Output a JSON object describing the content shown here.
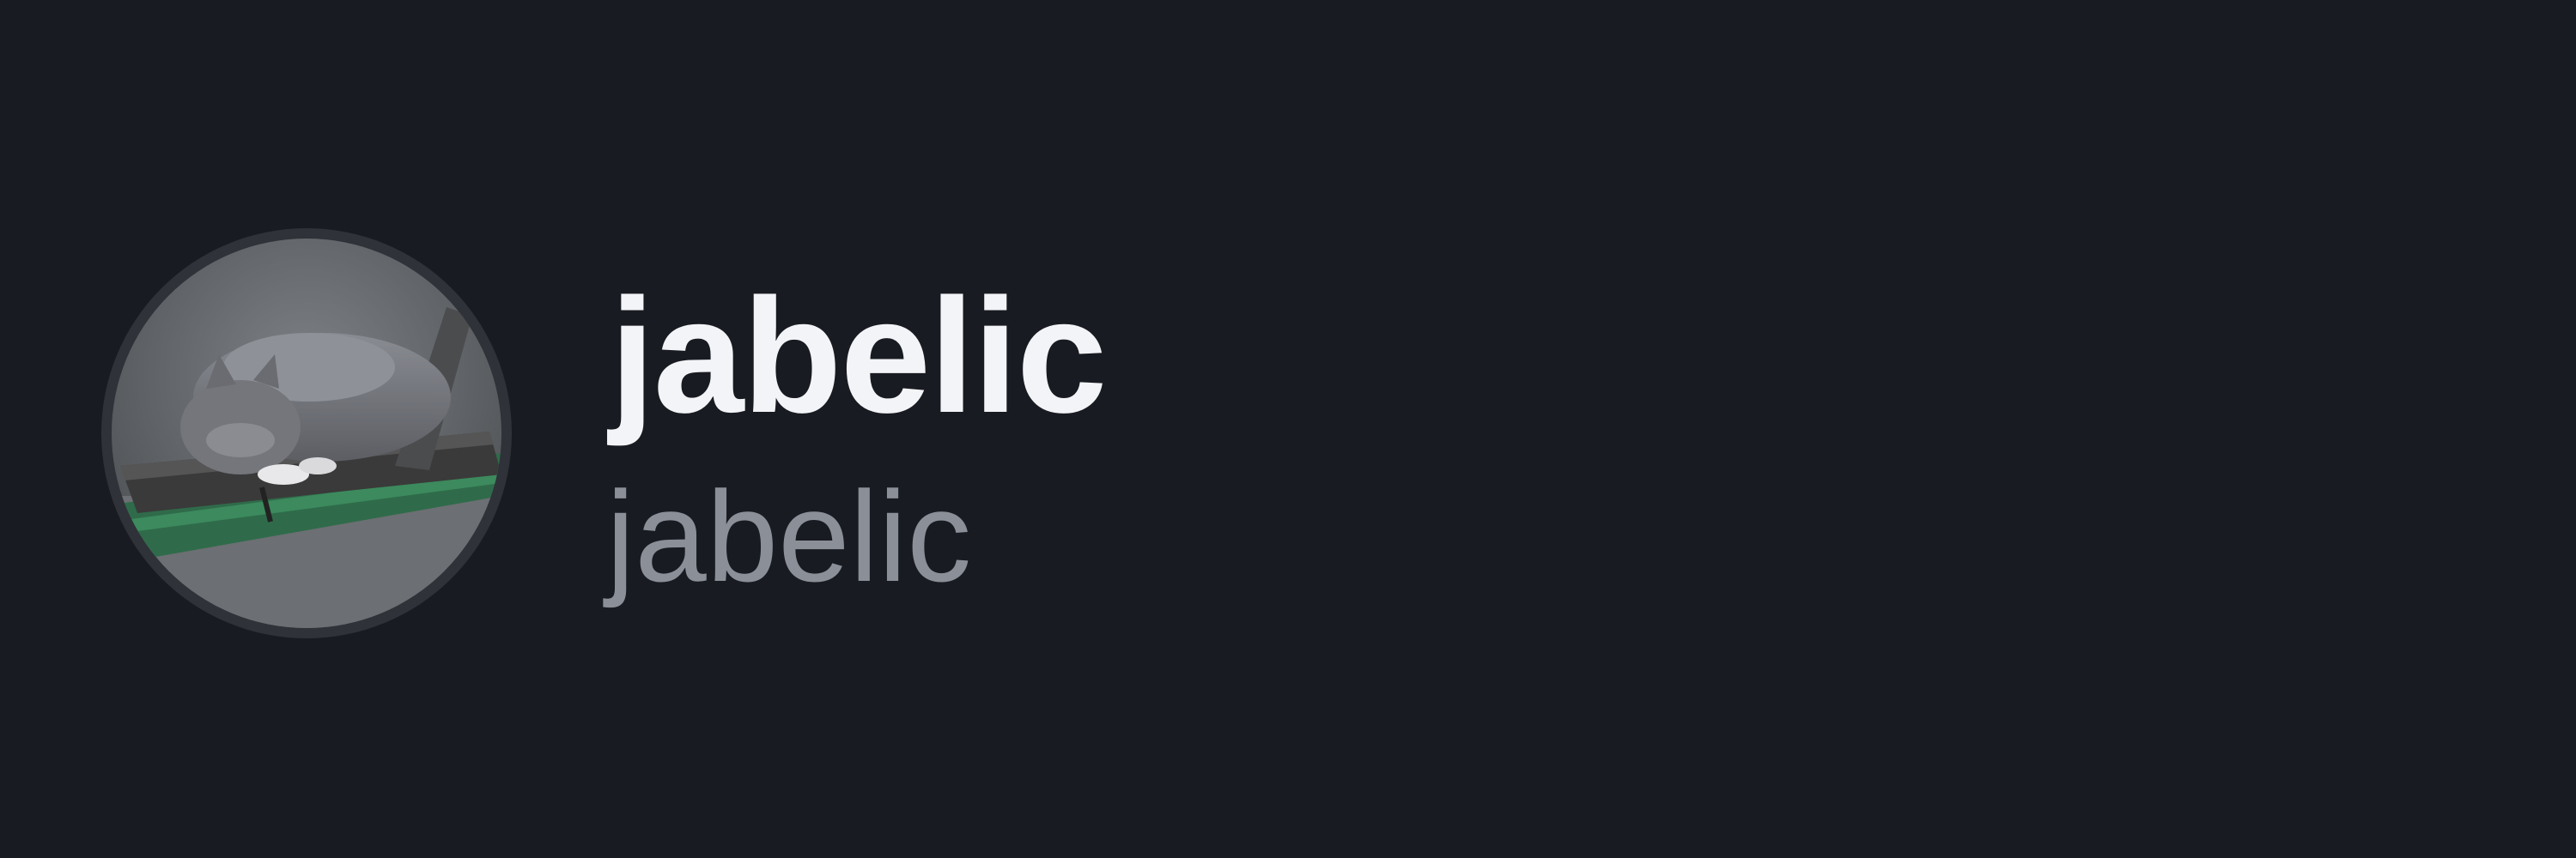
{
  "profile": {
    "display_name": "jabelic",
    "username": "jabelic",
    "avatar_icon": "sleeping-cat-avatar"
  },
  "colors": {
    "background": "#191b22",
    "display_name": "#f3f4f7",
    "username": "#8b8f98",
    "avatar_ring": "#2f3238"
  }
}
